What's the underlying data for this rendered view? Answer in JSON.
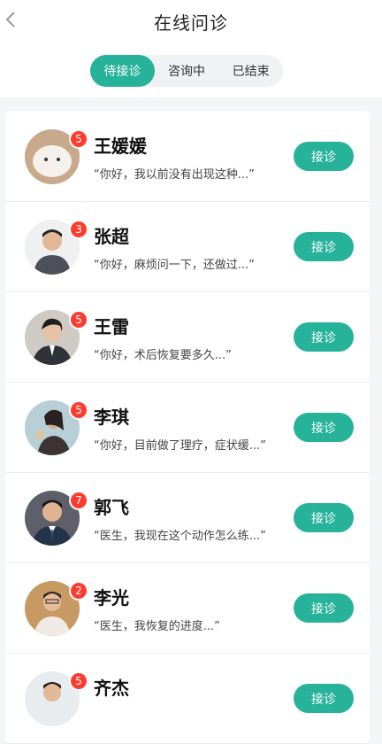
{
  "header": {
    "back_icon": "chevron-left-icon",
    "title": "在线问诊"
  },
  "tabs": [
    {
      "label": "待接诊",
      "active": true
    },
    {
      "label": "咨询中",
      "active": false
    },
    {
      "label": "已结束",
      "active": false
    }
  ],
  "patients": [
    {
      "name": "王媛媛",
      "badge": "5",
      "message": "“你好，我以前没有出现这种...”",
      "action": "接诊"
    },
    {
      "name": "张超",
      "badge": "3",
      "message": "“你好，麻烦问一下，还做过...”",
      "action": "接诊"
    },
    {
      "name": "王雷",
      "badge": "5",
      "message": "“你好，术后恢复要多久...”",
      "action": "接诊"
    },
    {
      "name": "李琪",
      "badge": "5",
      "message": "“你好，目前做了理疗，症状缓...”",
      "action": "接诊"
    },
    {
      "name": "郭飞",
      "badge": "7",
      "message": "“医生，我现在这个动作怎么练...”",
      "action": "接诊"
    },
    {
      "name": "李光",
      "badge": "2",
      "message": "“医生，我恢复的进度...”",
      "action": "接诊"
    },
    {
      "name": "齐杰",
      "badge": "5",
      "message": "",
      "action": "接诊"
    }
  ],
  "colors": {
    "accent": "#27b29a",
    "badge": "#ff3b30"
  }
}
